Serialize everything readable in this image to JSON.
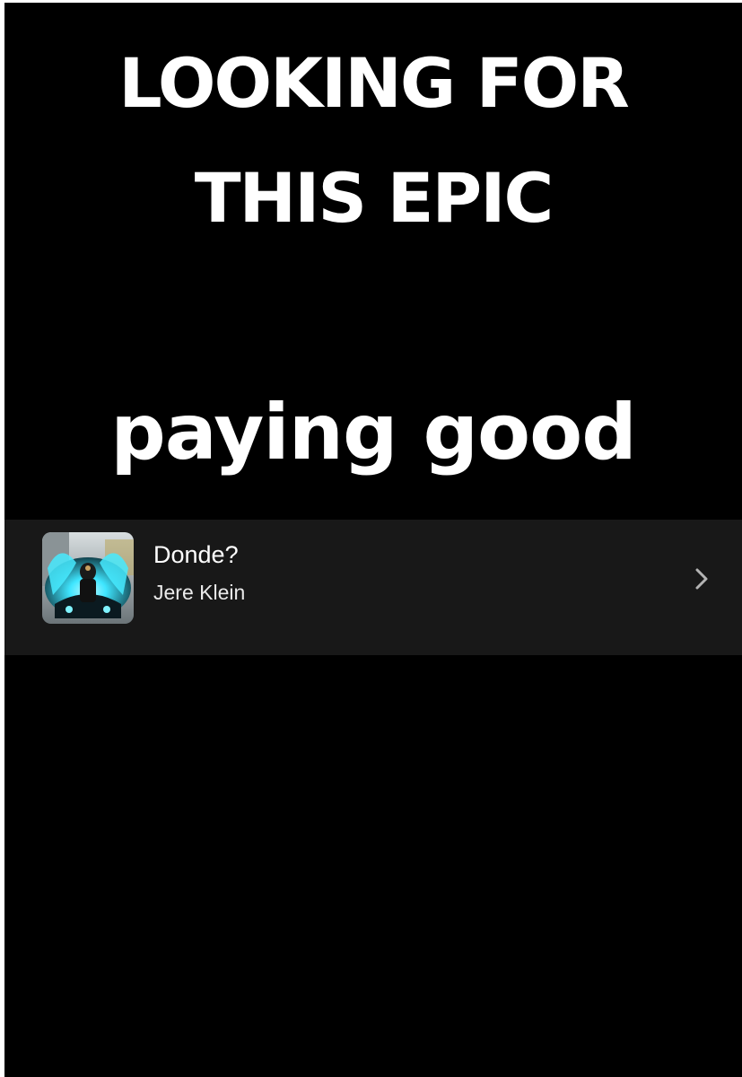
{
  "headline": {
    "line1": "LOOKING FOR",
    "line2": "THIS EPIC",
    "subline": "paying good"
  },
  "track": {
    "title": "Donde?",
    "artist": "Jere Klein",
    "cover_icon": "album-cover-image",
    "action_icon": "chevron-right-icon"
  },
  "colors": {
    "background": "#000000",
    "row_background": "#181818",
    "text": "#ffffff",
    "chevron": "#b3b3b3",
    "cover_glow": "#3fe6ff"
  }
}
